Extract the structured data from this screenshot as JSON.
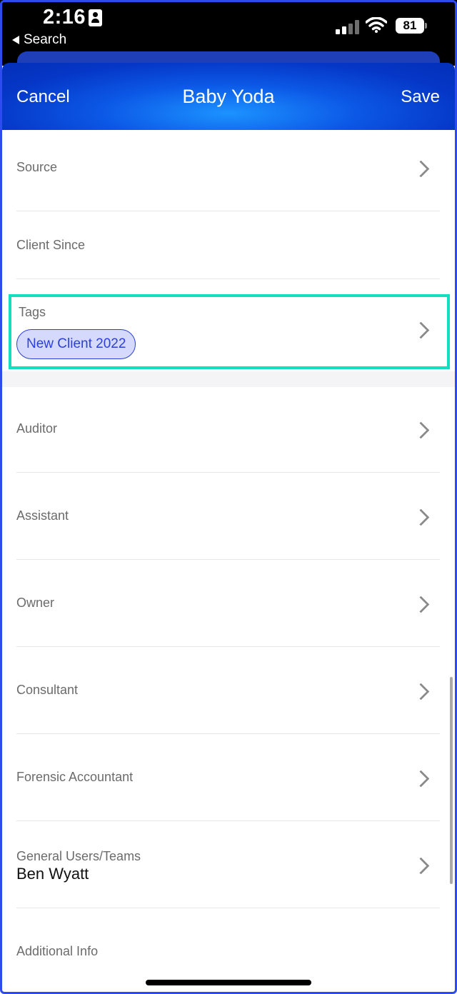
{
  "status_bar": {
    "time": "2:16",
    "back_label": "Search",
    "battery": "81"
  },
  "nav": {
    "cancel": "Cancel",
    "title": "Baby Yoda",
    "save": "Save"
  },
  "rows": {
    "source": "Source",
    "client_since": "Client Since",
    "tags": "Tags",
    "tag_chip": "New Client 2022",
    "auditor": "Auditor",
    "assistant": "Assistant",
    "owner": "Owner",
    "consultant": "Consultant",
    "forensic_accountant": "Forensic Accountant",
    "general_users": "General Users/Teams",
    "general_users_value": "Ben Wyatt",
    "additional_info": "Additional Info"
  },
  "colors": {
    "accent_blue": "#0c58e6",
    "highlight_teal": "#12dfc2",
    "tag_fill": "#d5dafc",
    "tag_text": "#2c3fd6"
  },
  "icons": {
    "row_disclosure": "chevron-right-icon",
    "status": [
      "contact-card-icon",
      "signal-icon",
      "wifi-icon",
      "battery-icon"
    ]
  }
}
